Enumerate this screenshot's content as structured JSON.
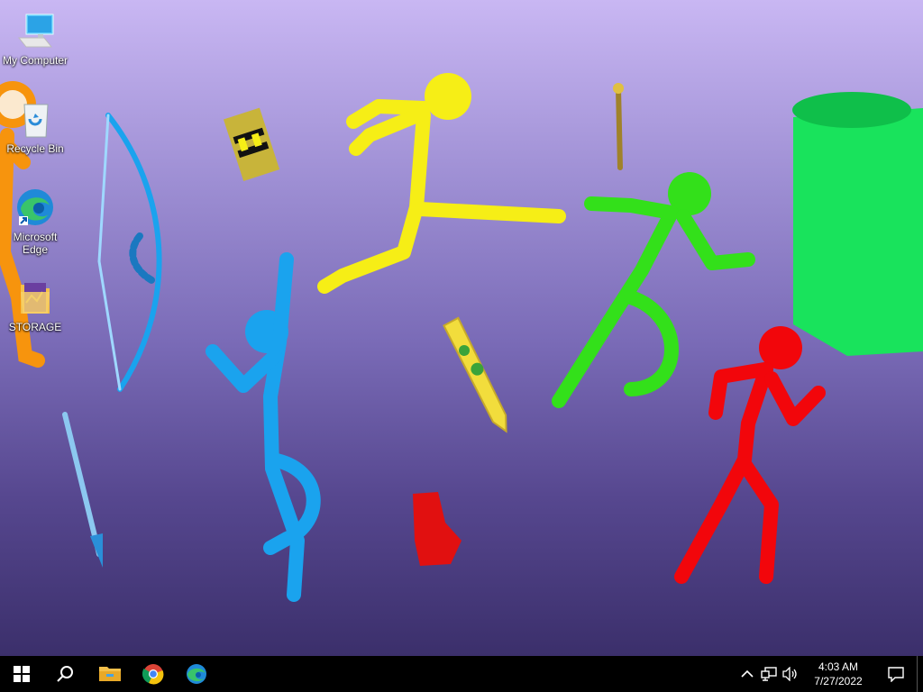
{
  "desktop": {
    "icons": [
      {
        "label": "My Computer",
        "icon": "computer-icon"
      },
      {
        "label": "Recycle Bin",
        "icon": "recycle-bin-icon"
      },
      {
        "label": "Microsoft Edge",
        "icon": "edge-icon"
      },
      {
        "label": "STORAGE",
        "icon": "folder-icon"
      }
    ]
  },
  "taskbar": {
    "start_icon": "windows-start-icon",
    "search_icon": "search-icon",
    "pinned": [
      {
        "icon": "file-explorer-icon"
      },
      {
        "icon": "chrome-icon"
      },
      {
        "icon": "edge-icon"
      }
    ]
  },
  "tray": {
    "icons": [
      "chevron-up-icon",
      "network-icon",
      "volume-icon"
    ],
    "time": "4:03 AM",
    "date": "7/27/2022",
    "notification_icon": "action-center-icon"
  },
  "colors": {
    "blue_figure": "#1aa3ee",
    "yellow_figure": "#f6ee16",
    "green_figure": "#33e01a",
    "red_figure": "#f2060b",
    "orange_figure": "#f7940d",
    "taskbar": "#000000"
  }
}
